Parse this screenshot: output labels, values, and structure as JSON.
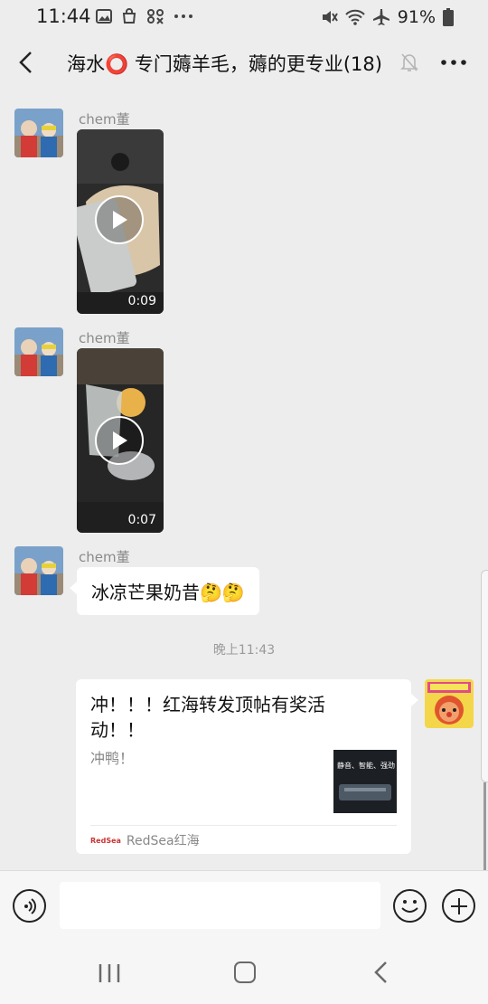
{
  "status_bar": {
    "time": "11:44",
    "battery": "91%"
  },
  "header": {
    "title": "海水⭕ 专门薅羊毛，薅的更专业(18)"
  },
  "messages": [
    {
      "sender": "chem董",
      "type": "video",
      "duration": "0:09"
    },
    {
      "sender": "chem董",
      "type": "video",
      "duration": "0:07"
    },
    {
      "sender": "chem董",
      "type": "text",
      "text": "冰凉芒果奶昔🤔🤔"
    }
  ],
  "timestamp": "晚上11:43",
  "share_card": {
    "title": "冲！！！红海转发顶帖有奖活动！！",
    "description": "冲鸭！",
    "thumbnail_text": "静音、智能、强劲",
    "source": "RedSea红海",
    "source_logo": "RedSea"
  },
  "colors": {
    "background": "#ededed",
    "bubble": "#ffffff",
    "meta_text": "#8a8a8a"
  },
  "icons": {
    "back": "back-arrow-icon",
    "mute": "mute-bell-icon",
    "more": "more-icon",
    "voice": "voice-icon",
    "emoji": "emoji-icon",
    "plus": "plus-icon"
  }
}
